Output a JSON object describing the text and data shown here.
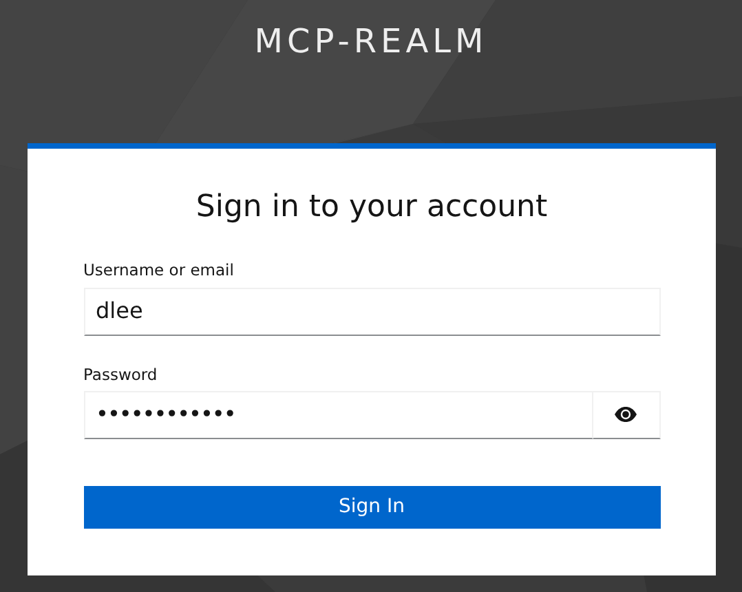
{
  "realm": {
    "title": "MCP-REALM"
  },
  "card": {
    "heading": "Sign in to your account",
    "fields": [
      {
        "kind": "text",
        "label": "Username or email",
        "value": "dlee"
      },
      {
        "kind": "password",
        "label": "Password",
        "value": "••••••••••••"
      }
    ],
    "submit": "Sign In"
  }
}
